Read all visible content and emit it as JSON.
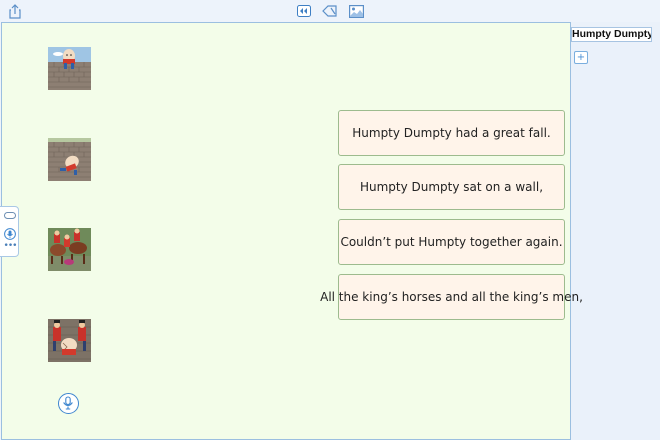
{
  "toolbar": {
    "share_icon": "share-icon",
    "view_icon": "view-mode-icon",
    "shape_icon": "shape-icon",
    "image_icon": "image-icon"
  },
  "document": {
    "title": "Humpty Dumpty",
    "add_page_label": "+"
  },
  "left_toolbox": {
    "more_label": "•••"
  },
  "pictures": [
    {
      "alt": "Humpty Dumpty sitting on a wall"
    },
    {
      "alt": "Humpty Dumpty falling off the wall"
    },
    {
      "alt": "The king's horses and men"
    },
    {
      "alt": "The king's men around broken Humpty"
    }
  ],
  "cards": [
    {
      "text": "Humpty Dumpty had a great fall."
    },
    {
      "text": "Humpty Dumpty sat on a wall,"
    },
    {
      "text": "Couldn’t put Humpty together again."
    },
    {
      "text": "All the king’s horses and all the king’s men,"
    }
  ],
  "colors": {
    "canvas_bg": "#f3fde9",
    "card_bg": "#fff4ea",
    "accent": "#3e86cf"
  }
}
